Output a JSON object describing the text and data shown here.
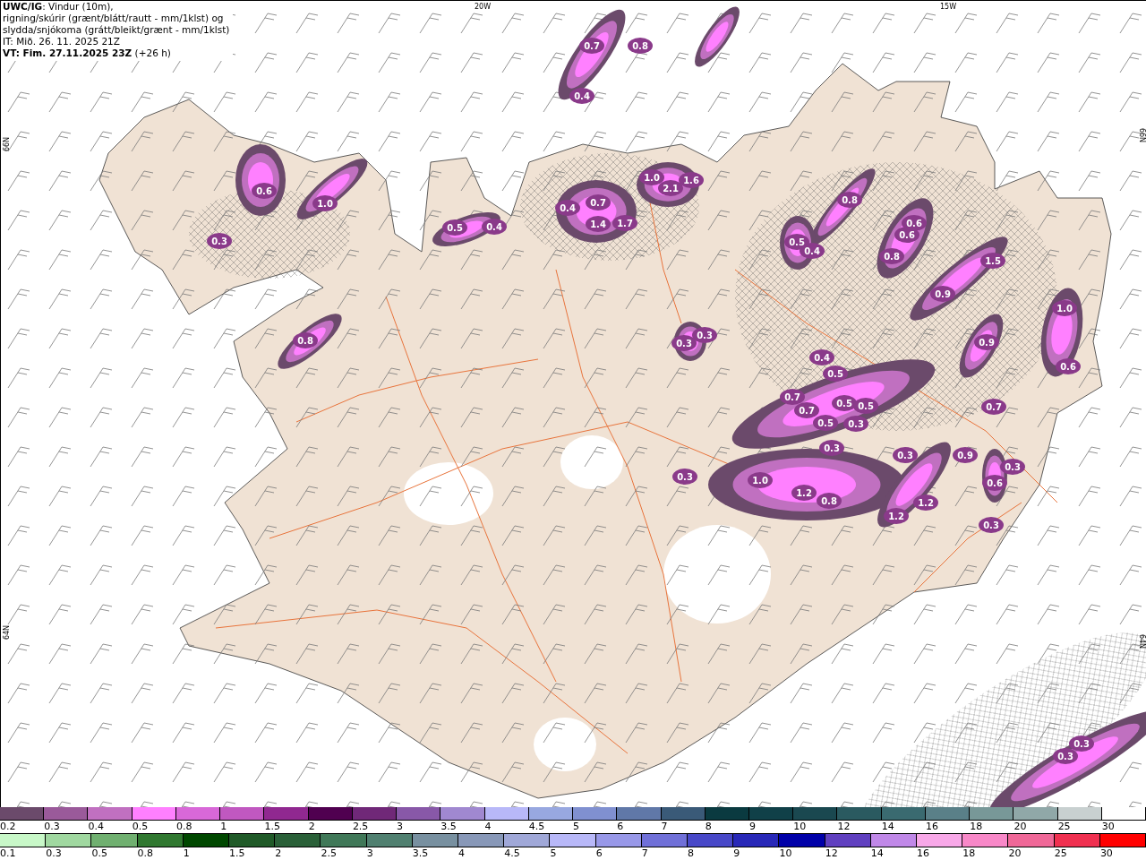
{
  "header": {
    "lines": [
      "**UWC/IG**: Vindur (10m),",
      "rigning/skúrir (grænt/blátt/rautt - mm/1klst) og",
      "slydda/snjókoma (grátt/bleikt/grænt - mm/1klst)",
      "IT: Mið. 26. 11. 2025 21Z",
      "**VT: Fim. 27.11.2025 23Z** (+26 h)"
    ]
  },
  "map": {
    "longitude_labels": [
      "20W",
      "15W"
    ],
    "latitude_labels_left": [
      "66N",
      "64N"
    ],
    "latitude_labels_right": [
      "66N",
      "64N"
    ],
    "precip_labels": [
      "0.7",
      "0.8",
      "0.4",
      "0.6",
      "1.0",
      "0.3",
      "0.5",
      "0.4",
      "0.4",
      "0.7",
      "1.4",
      "1.7",
      "1.0",
      "2.1",
      "1.6",
      "0.8",
      "0.3",
      "0.3",
      "0.5",
      "0.4",
      "0.8",
      "0.6",
      "0.6",
      "0.8",
      "1.5",
      "0.9",
      "1.0",
      "0.9",
      "0.6",
      "0.4",
      "0.5",
      "0.7",
      "0.7",
      "0.5",
      "0.5",
      "0.5",
      "0.3",
      "0.3",
      "0.3",
      "1.0",
      "1.2",
      "0.8",
      "0.7",
      "0.9",
      "0.3",
      "0.3",
      "0.6",
      "1.2",
      "1.2",
      "0.3",
      "0.3",
      "0.3"
    ]
  },
  "legend_snow": [
    {
      "label": "0.2",
      "color": "#6b4a6b"
    },
    {
      "label": "0.3",
      "color": "#9a5a9a"
    },
    {
      "label": "0.4",
      "color": "#c070c0"
    },
    {
      "label": "0.5",
      "color": "#ff80ff"
    },
    {
      "label": "0.8",
      "color": "#d868d8"
    },
    {
      "label": "1",
      "color": "#c058c0"
    },
    {
      "label": "1.5",
      "color": "#902890"
    },
    {
      "label": "2",
      "color": "#500050"
    },
    {
      "label": "2.5",
      "color": "#702878"
    },
    {
      "label": "3",
      "color": "#8858a8"
    },
    {
      "label": "3.5",
      "color": "#a088d0"
    },
    {
      "label": "4",
      "color": "#b8b8f8"
    },
    {
      "label": "4.5",
      "color": "#98a8e0"
    },
    {
      "label": "5",
      "color": "#8090d0"
    },
    {
      "label": "6",
      "color": "#6078a8"
    },
    {
      "label": "7",
      "color": "#3a5a78"
    },
    {
      "label": "8",
      "color": "#0a3a40"
    },
    {
      "label": "9",
      "color": "#104048"
    },
    {
      "label": "10",
      "color": "#1a4850"
    },
    {
      "label": "12",
      "color": "#2a5a60"
    },
    {
      "label": "14",
      "color": "#3a6a70"
    },
    {
      "label": "16",
      "color": "#5a8088"
    },
    {
      "label": "18",
      "color": "#789898"
    },
    {
      "label": "20",
      "color": "#90a8a8"
    },
    {
      "label": "25",
      "color": "#c8d0d0"
    },
    {
      "label": "30",
      "color": "#ffffff"
    }
  ],
  "legend_rain": [
    {
      "label": "0.1",
      "color": "#c8f8c8"
    },
    {
      "label": "0.3",
      "color": "#a0d8a0"
    },
    {
      "label": "0.5",
      "color": "#70b070"
    },
    {
      "label": "0.8",
      "color": "#307830"
    },
    {
      "label": "1",
      "color": "#004800"
    },
    {
      "label": "1.5",
      "color": "#205a28"
    },
    {
      "label": "2",
      "color": "#2a6038"
    },
    {
      "label": "2.5",
      "color": "#407858"
    },
    {
      "label": "3",
      "color": "#508070"
    },
    {
      "label": "3.5",
      "color": "#7890a0"
    },
    {
      "label": "4",
      "color": "#8898b8"
    },
    {
      "label": "4.5",
      "color": "#a0a8d8"
    },
    {
      "label": "5",
      "color": "#b8b8f8"
    },
    {
      "label": "6",
      "color": "#9898e8"
    },
    {
      "label": "7",
      "color": "#7070d8"
    },
    {
      "label": "8",
      "color": "#4848c8"
    },
    {
      "label": "9",
      "color": "#2828b8"
    },
    {
      "label": "10",
      "color": "#0000a8"
    },
    {
      "label": "12",
      "color": "#6040c0"
    },
    {
      "label": "14",
      "color": "#c088e8"
    },
    {
      "label": "16",
      "color": "#f8a8e8"
    },
    {
      "label": "18",
      "color": "#f888c8"
    },
    {
      "label": "20",
      "color": "#f06898"
    },
    {
      "label": "25",
      "color": "#f03050"
    },
    {
      "label": "30",
      "color": "#ff0000"
    }
  ]
}
